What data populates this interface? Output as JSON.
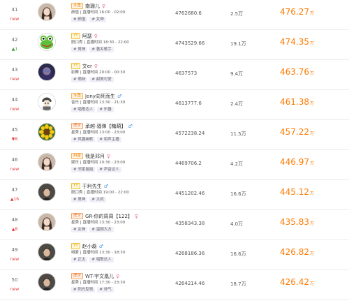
{
  "rows": [
    {
      "rank": "41",
      "tag": "new",
      "tag_type": "new",
      "platform": "斗鱼",
      "platform_type": "dou",
      "name": "南珊儿",
      "gender": "female",
      "detail": "颜值 | 直播时间 16:00 - 02:00",
      "tags": [
        "# 颜值",
        "# 女神"
      ],
      "num": "4762680.6",
      "fans": "2.5万",
      "score": "476.27",
      "unit": "万",
      "avatar": "portrait-woman-icon"
    },
    {
      "rank": "42",
      "tag": "▲1",
      "tag_type": "up",
      "platform": "YY",
      "platform_type": "yy",
      "name": "阿瑟",
      "gender": "female",
      "detail": "脱口秀 | 直播时间 18:30 - 22:00",
      "tags": [
        "# 男神",
        "# 著名歌手"
      ],
      "num": "4743529.66",
      "fans": "19.1万",
      "score": "474.35",
      "unit": "万",
      "avatar": "frog-icon"
    },
    {
      "rank": "43",
      "tag": "new",
      "tag_type": "new",
      "platform": "YY",
      "platform_type": "yy",
      "name": "文er",
      "gender": "female",
      "detail": "影舞 | 直播时间 20:00 - 00:30",
      "tags": [
        "# 萌妹",
        "# 甜美可爱"
      ],
      "num": "4637573",
      "fans": "9.4万",
      "score": "463.76",
      "unit": "万",
      "avatar": "anime-girl-icon"
    },
    {
      "rank": "44",
      "tag": "new",
      "tag_type": "new",
      "platform": "斗鱼",
      "platform_type": "dou",
      "name": "Jony向死而生",
      "gender": "male",
      "detail": "音乐 | 直播时间 13:30 - 21:30",
      "tags": [
        "# 唱歌达人",
        "# 乐器"
      ],
      "num": "4613777.6",
      "fans": "2.4万",
      "score": "461.38",
      "unit": "万",
      "avatar": "cartoon-boy-icon"
    },
    {
      "rank": "45",
      "tag": "▼8",
      "tag_type": "down",
      "platform": "虎牙",
      "platform_type": "hu",
      "name": "承越-骚俤【糖葫】",
      "gender": "male",
      "detail": "星秀 | 直播时间 13:00 - 23:00",
      "tags": [
        "# 风趣幽默",
        "# 相声主播"
      ],
      "num": "4572238.24",
      "fans": "11.5万",
      "score": "457.22",
      "unit": "万",
      "avatar": "sunflower-icon"
    },
    {
      "rank": "46",
      "tag": "new",
      "tag_type": "new",
      "platform": "抖音",
      "platform_type": "dou",
      "name": "我是邓月",
      "gender": "female",
      "detail": "娱乐 | 直播时间 20:30 - 23:00",
      "tags": [
        "# 邻家姐姐",
        "# 声音达人"
      ],
      "num": "4469706.2",
      "fans": "4.2万",
      "score": "446.97",
      "unit": "万",
      "avatar": "portrait-woman-icon"
    },
    {
      "rank": "47",
      "tag": "▲16",
      "tag_type": "down",
      "platform": "YY",
      "platform_type": "yy",
      "name": "于利先生",
      "gender": "male",
      "detail": "脱口秀 | 直播时间 19:00 - 22:00",
      "tags": [
        "# 男神",
        "# 大叔"
      ],
      "num": "4451202.46",
      "fans": "16.6万",
      "score": "445.12",
      "unit": "万",
      "avatar": "portrait-man-icon"
    },
    {
      "rank": "48",
      "tag": "▲8",
      "tag_type": "down",
      "platform": "虎牙",
      "platform_type": "hu",
      "name": "GR-你的周周【122】",
      "gender": "female",
      "detail": "星秀 | 直播时间 13:30 - 23:00",
      "tags": [
        "# 女神",
        "# 温婉大方"
      ],
      "num": "4358343.38",
      "fans": "4.0万",
      "score": "435.83",
      "unit": "万",
      "avatar": "portrait-woman-icon"
    },
    {
      "rank": "49",
      "tag": "new",
      "tag_type": "new",
      "platform": "YY",
      "platform_type": "yy",
      "name": "赵小磊",
      "gender": "male",
      "detail": "喊麦 | 直播时间 13:30 - 18:30",
      "tags": [
        "# 正太",
        "# 唱歌达人"
      ],
      "num": "4268186.36",
      "fans": "16.6万",
      "score": "426.82",
      "unit": "万",
      "avatar": "portrait-man-icon"
    },
    {
      "rank": "50",
      "tag": "new",
      "tag_type": "new",
      "platform": "虎牙",
      "platform_type": "hu",
      "name": "WT-宇文凰儿",
      "gender": "female",
      "detail": "星秀 | 直播时间 17:30 - 23:30",
      "tags": [
        "# 阳光型男",
        "# 帅气"
      ],
      "num": "4264214.46",
      "fans": "18.7万",
      "score": "426.42",
      "unit": "万",
      "avatar": "portrait-man-icon"
    }
  ],
  "colors": {
    "score": "#ff7a00",
    "new": "#e63b3b",
    "up": "#3aa13a"
  }
}
